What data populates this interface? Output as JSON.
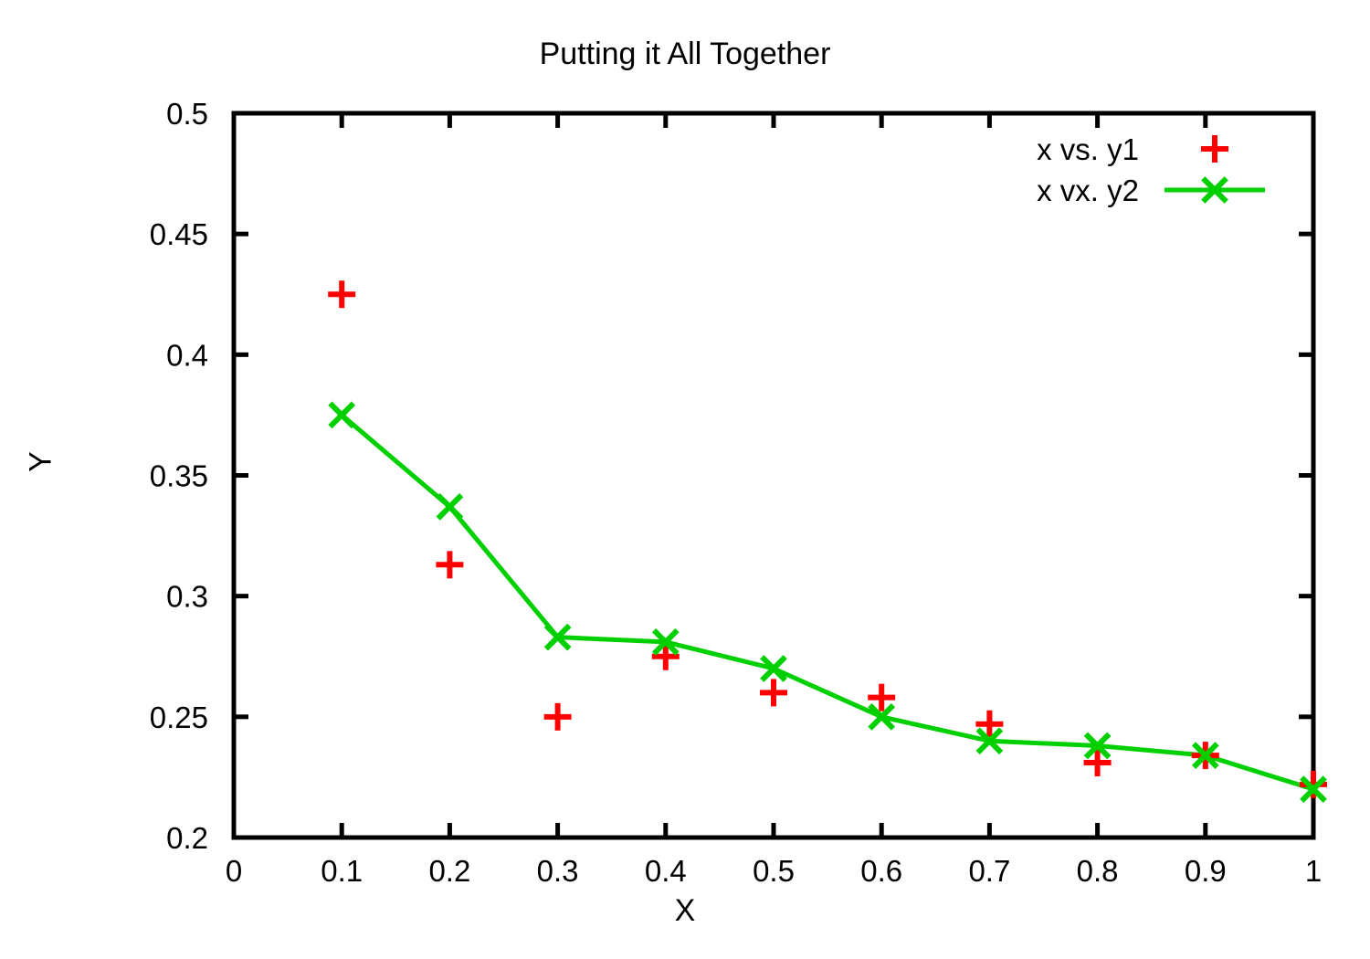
{
  "chart_data": {
    "type": "scatter",
    "title": "Putting it All Together",
    "xlabel": "X",
    "ylabel": "Y",
    "xlim": [
      0,
      1
    ],
    "ylim": [
      0.2,
      0.5
    ],
    "xticks": [
      "0",
      "0.1",
      "0.2",
      "0.3",
      "0.4",
      "0.5",
      "0.6",
      "0.7",
      "0.8",
      "0.9",
      "1"
    ],
    "xtick_values": [
      0,
      0.1,
      0.2,
      0.3,
      0.4,
      0.5,
      0.6,
      0.7,
      0.8,
      0.9,
      1
    ],
    "yticks": [
      "0.2",
      "0.25",
      "0.3",
      "0.35",
      "0.4",
      "0.45",
      "0.5"
    ],
    "ytick_values": [
      0.2,
      0.25,
      0.3,
      0.35,
      0.4,
      0.45,
      0.5
    ],
    "grid": false,
    "legend_position": "top-right",
    "x": [
      0.1,
      0.2,
      0.3,
      0.4,
      0.5,
      0.6,
      0.7,
      0.8,
      0.9,
      1.0
    ],
    "series": [
      {
        "name": "x vs. y1",
        "marker": "plus",
        "color": "#ff0000",
        "line": false,
        "values": [
          0.425,
          0.313,
          0.25,
          0.275,
          0.26,
          0.258,
          0.247,
          0.231,
          0.234,
          0.222
        ]
      },
      {
        "name": "x vx. y2",
        "marker": "cross",
        "color": "#00d000",
        "line": true,
        "values": [
          0.375,
          0.337,
          0.283,
          0.281,
          0.27,
          0.25,
          0.24,
          0.238,
          0.234,
          0.22
        ]
      }
    ]
  },
  "legend": {
    "entries": [
      {
        "label": "x vs. y1"
      },
      {
        "label": "x vx. y2"
      }
    ]
  },
  "colors": {
    "series1": "#ff0000",
    "series2": "#00d000",
    "axis": "#000000",
    "background": "#ffffff"
  }
}
